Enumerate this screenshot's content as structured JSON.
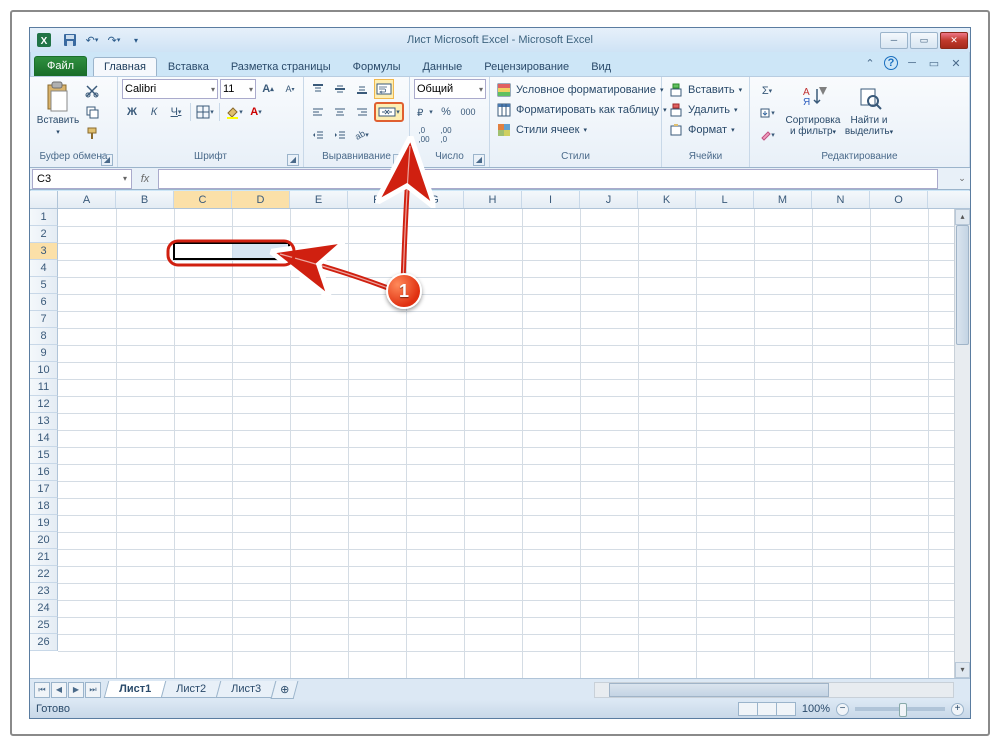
{
  "window": {
    "title": "Лист Microsoft Excel - Microsoft Excel"
  },
  "qat": {
    "save": "💾",
    "undo": "↶",
    "redo": "↷"
  },
  "tabs": {
    "file": "Файл",
    "items": [
      "Главная",
      "Вставка",
      "Разметка страницы",
      "Формулы",
      "Данные",
      "Рецензирование",
      "Вид"
    ],
    "active_index": 0
  },
  "ribbon": {
    "clipboard": {
      "paste": "Вставить",
      "label": "Буфер обмена"
    },
    "font": {
      "name": "Calibri",
      "size": "11",
      "bold": "Ж",
      "italic": "К",
      "underline": "Ч",
      "grow": "A",
      "shrink": "A",
      "label": "Шрифт"
    },
    "align": {
      "label": "Выравнивание"
    },
    "number": {
      "format": "Общий",
      "label": "Число"
    },
    "styles": {
      "cond": "Условное форматирование",
      "table": "Форматировать как таблицу",
      "cell": "Стили ячеек",
      "label": "Стили"
    },
    "cells": {
      "insert": "Вставить",
      "delete": "Удалить",
      "format": "Формат",
      "label": "Ячейки"
    },
    "editing": {
      "sum": "Σ",
      "fill": "⬇",
      "clear": "◇",
      "sort": "Сортировка и фильтр",
      "find": "Найти и выделить",
      "label": "Редактирование"
    }
  },
  "formula_bar": {
    "name_box": "C3",
    "fx": "fx"
  },
  "grid": {
    "columns": [
      "A",
      "B",
      "C",
      "D",
      "E",
      "F",
      "G",
      "H",
      "I",
      "J",
      "K",
      "L",
      "M",
      "N",
      "O"
    ],
    "rows": 26,
    "selected_cols": [
      "C",
      "D"
    ],
    "selected_row": 3,
    "selection": {
      "from": "C3",
      "to": "D3"
    }
  },
  "sheets": {
    "tabs": [
      "Лист1",
      "Лист2",
      "Лист3"
    ],
    "active_index": 0
  },
  "status": {
    "ready": "Готово",
    "zoom": "100%"
  },
  "callout": {
    "number": "1"
  }
}
